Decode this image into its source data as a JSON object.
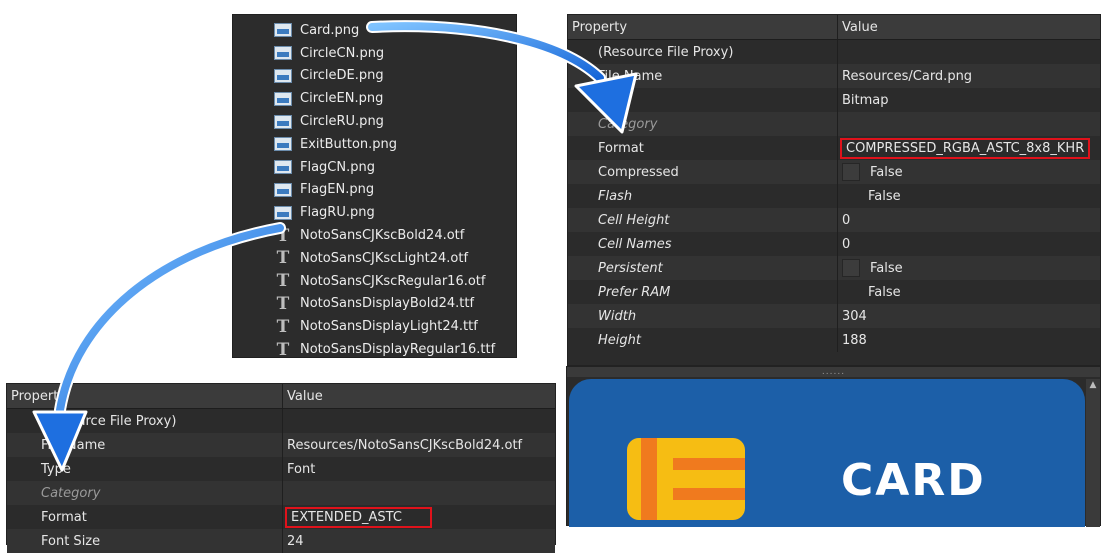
{
  "file_list": {
    "items": [
      {
        "name": "Card.png",
        "icon": "image-file-icon"
      },
      {
        "name": "CircleCN.png",
        "icon": "image-file-icon"
      },
      {
        "name": "CircleDE.png",
        "icon": "image-file-icon"
      },
      {
        "name": "CircleEN.png",
        "icon": "image-file-icon"
      },
      {
        "name": "CircleRU.png",
        "icon": "image-file-icon"
      },
      {
        "name": "ExitButton.png",
        "icon": "image-file-icon"
      },
      {
        "name": "FlagCN.png",
        "icon": "image-file-icon"
      },
      {
        "name": "FlagEN.png",
        "icon": "image-file-icon"
      },
      {
        "name": "FlagRU.png",
        "icon": "image-file-icon"
      },
      {
        "name": "NotoSansCJKscBold24.otf",
        "icon": "font-file-icon"
      },
      {
        "name": "NotoSansCJKscLight24.otf",
        "icon": "font-file-icon"
      },
      {
        "name": "NotoSansCJKscRegular16.otf",
        "icon": "font-file-icon"
      },
      {
        "name": "NotoSansDisplayBold24.ttf",
        "icon": "font-file-icon"
      },
      {
        "name": "NotoSansDisplayLight24.ttf",
        "icon": "font-file-icon"
      },
      {
        "name": "NotoSansDisplayRegular16.ttf",
        "icon": "font-file-icon"
      }
    ]
  },
  "right_grid": {
    "header_property": "Property",
    "header_value": "Value",
    "rows": [
      {
        "prop": "(Resource File Proxy)",
        "value": ""
      },
      {
        "prop": "File Name",
        "value": "Resources/Card.png"
      },
      {
        "prop": "Type",
        "value": "Bitmap"
      },
      {
        "prop": "Category",
        "value": ""
      },
      {
        "prop": "Format",
        "value": "COMPRESSED_RGBA_ASTC_8x8_KHR"
      },
      {
        "prop": "Compressed",
        "value": "False"
      },
      {
        "prop": "Flash",
        "value": "False"
      },
      {
        "prop": "Cell Height",
        "value": "0"
      },
      {
        "prop": "Cell Names",
        "value": "0"
      },
      {
        "prop": "Persistent",
        "value": "False"
      },
      {
        "prop": "Prefer RAM",
        "value": "False"
      },
      {
        "prop": "Width",
        "value": "304"
      },
      {
        "prop": "Height",
        "value": "188"
      }
    ]
  },
  "left_grid": {
    "header_property": "Property",
    "header_value": "Value",
    "rows": [
      {
        "prop": "(Resource File Proxy)",
        "value": ""
      },
      {
        "prop": "File Name",
        "value": "Resources/NotoSansCJKscBold24.otf"
      },
      {
        "prop": "Type",
        "value": "Font"
      },
      {
        "prop": "Category",
        "value": ""
      },
      {
        "prop": "Format",
        "value": "EXTENDED_ASTC"
      },
      {
        "prop": "Font Size",
        "value": "24"
      }
    ]
  },
  "preview": {
    "splitter_grip": "......",
    "card_text": "CARD"
  },
  "colors": {
    "highlight": "#e0121b",
    "arrow": "#1e78e6",
    "card_blue": "#1c5fa8",
    "card_yellow": "#f6bd13",
    "card_orange": "#f07a1e"
  }
}
